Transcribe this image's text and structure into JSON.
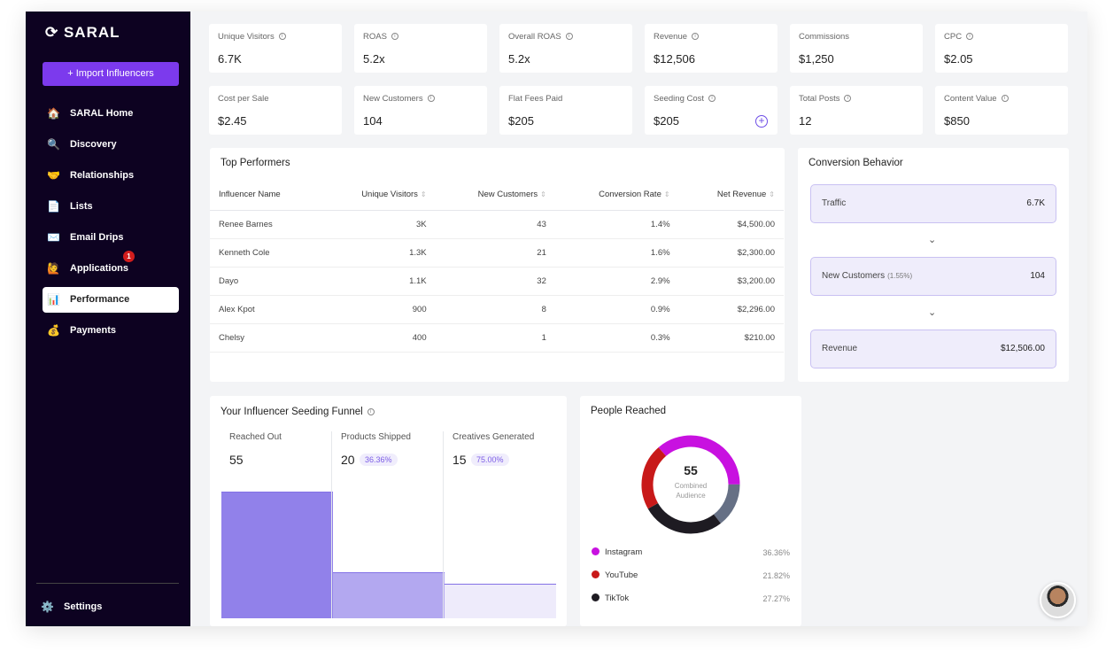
{
  "sidebar": {
    "logo": "SARAL",
    "import_label": "+  Import Influencers",
    "items": [
      {
        "label": "SARAL Home",
        "icon": "🏠"
      },
      {
        "label": "Discovery",
        "icon": "🔍"
      },
      {
        "label": "Relationships",
        "icon": "🤝"
      },
      {
        "label": "Lists",
        "icon": "📄"
      },
      {
        "label": "Email Drips",
        "icon": "✉️"
      },
      {
        "label": "Applications",
        "icon": "🙋",
        "badge": "1"
      },
      {
        "label": "Performance",
        "icon": "📊",
        "active": true
      },
      {
        "label": "Payments",
        "icon": "💰"
      }
    ],
    "settings": {
      "label": "Settings",
      "icon": "⚙️"
    }
  },
  "stats": [
    {
      "label": "Unique Visitors",
      "value": "6.7K",
      "info": true
    },
    {
      "label": "ROAS",
      "value": "5.2x",
      "info": true
    },
    {
      "label": "Overall ROAS",
      "value": "5.2x",
      "info": true
    },
    {
      "label": "Revenue",
      "value": "$12,506",
      "info": true
    },
    {
      "label": "Commissions",
      "value": "$1,250"
    },
    {
      "label": "CPC",
      "value": "$2.05",
      "info": true
    },
    {
      "label": "Cost per Sale",
      "value": "$2.45"
    },
    {
      "label": "New Customers",
      "value": "104",
      "info": true
    },
    {
      "label": "Flat Fees Paid",
      "value": "$205"
    },
    {
      "label": "Seeding Cost",
      "value": "$205",
      "info": true
    },
    {
      "label": "Total Posts",
      "value": "12",
      "info": true
    },
    {
      "label": "Content Value",
      "value": "$850",
      "info": true
    }
  ],
  "top_performers": {
    "title": "Top Performers",
    "columns": [
      "Influencer Name",
      "Unique Visitors",
      "New Customers",
      "Conversion Rate",
      "Net Revenue"
    ],
    "rows": [
      [
        "Renee Barnes",
        "3K",
        "43",
        "1.4%",
        "$4,500.00"
      ],
      [
        "Kenneth Cole",
        "1.3K",
        "21",
        "1.6%",
        "$2,300.00"
      ],
      [
        "Dayo",
        "1.1K",
        "32",
        "2.9%",
        "$3,200.00"
      ],
      [
        "Alex Kpot",
        "900",
        "8",
        "0.9%",
        "$2,296.00"
      ],
      [
        "Chelsy",
        "400",
        "1",
        "0.3%",
        "$210.00"
      ]
    ]
  },
  "conversion": {
    "title": "Conversion Behavior",
    "steps": [
      {
        "label": "Traffic",
        "sub": "",
        "value": "6.7K"
      },
      {
        "label": "New Customers",
        "sub": "(1.55%)",
        "value": "104"
      },
      {
        "label": "Revenue",
        "sub": "",
        "value": "$12,506.00"
      }
    ]
  },
  "funnel": {
    "title": "Your Influencer Seeding Funnel",
    "stages": [
      {
        "label": "Reached Out",
        "value": 55,
        "pct": ""
      },
      {
        "label": "Products Shipped",
        "value": 20,
        "pct": "36.36%"
      },
      {
        "label": "Creatives Generated",
        "value": 15,
        "pct": "75.00%"
      }
    ],
    "colors": [
      "#9181ea",
      "#b3a8f0",
      "#eeebfb"
    ]
  },
  "people_reached": {
    "title": "People Reached",
    "total": "55",
    "center_label_1": "Combined",
    "center_label_2": "Audience",
    "segments": [
      {
        "name": "Instagram",
        "pct": 36.36,
        "pct_label": "36.36%",
        "color": "#c811e0",
        "legend": true
      },
      {
        "name": "Other",
        "pct": 14.55,
        "color": "#667085",
        "legend": false
      },
      {
        "name": "TikTok",
        "pct": 27.27,
        "pct_label": "27.27%",
        "color": "#1e1b22",
        "legend": true
      },
      {
        "name": "YouTube",
        "pct": 21.82,
        "pct_label": "21.82%",
        "color": "#c81919",
        "legend": true
      }
    ],
    "legend_order": [
      "Instagram",
      "YouTube",
      "TikTok"
    ]
  }
}
